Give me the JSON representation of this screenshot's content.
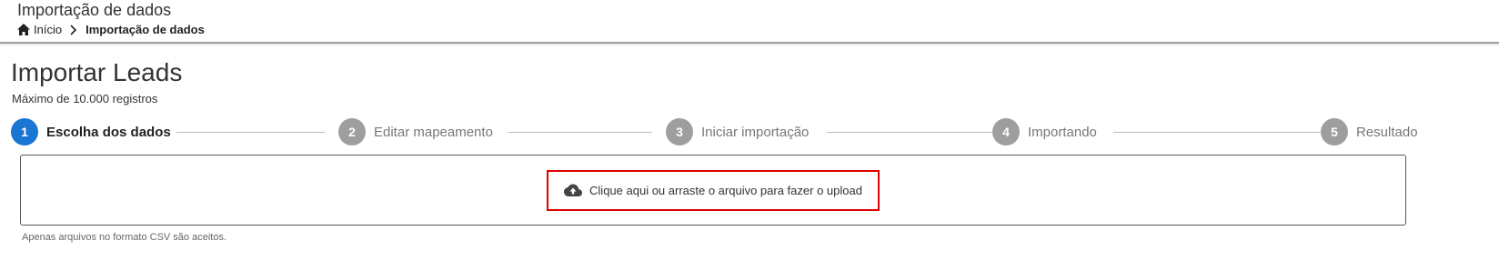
{
  "header": {
    "title": "Importação de dados",
    "breadcrumb": {
      "home_label": "Início",
      "current_label": "Importação de dados"
    }
  },
  "main": {
    "title": "Importar Leads",
    "subtitle": "Máximo de 10.000 registros",
    "steps": [
      {
        "number": "1",
        "label": "Escolha dos dados",
        "active": true
      },
      {
        "number": "2",
        "label": "Editar mapeamento",
        "active": false
      },
      {
        "number": "3",
        "label": "Iniciar importação",
        "active": false
      },
      {
        "number": "4",
        "label": "Importando",
        "active": false
      },
      {
        "number": "5",
        "label": "Resultado",
        "active": false
      }
    ],
    "upload": {
      "icon": "cloud-upload-icon",
      "text": "Clique aqui ou arraste o arquivo para fazer o upload"
    },
    "hint": "Apenas arquivos no formato CSV são aceitos."
  },
  "colors": {
    "active_step": "#1976d2",
    "inactive_step": "#9e9e9e",
    "highlight_border": "#e00000"
  }
}
